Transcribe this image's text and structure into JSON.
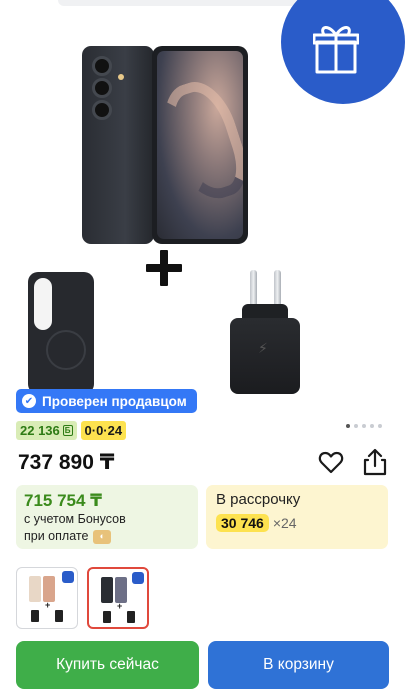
{
  "product": {
    "images": {
      "current_index": 1,
      "count": 5
    },
    "seller_badge": "Проверен продавцом",
    "bonus_chip": "22 136",
    "bonus_chip_unit": "Б",
    "installment_chip": "0·0·24",
    "price": "737 890 ₸",
    "bonus_box": {
      "amount": "715 754 ₸",
      "line1": "с учетом Бонусов",
      "line2": "при оплате"
    },
    "installment_box": {
      "title": "В рассрочку",
      "monthly": "30 746",
      "months": "×24"
    }
  },
  "icons": {
    "gift": "gift-icon",
    "favorite": "heart-icon",
    "share": "share-icon",
    "verified": "check-circle-icon"
  },
  "actions": {
    "buy_now": "Купить сейчас",
    "add_to_cart": "В корзину"
  },
  "colors": {
    "buy": "#3fae49",
    "cart": "#2f72d6",
    "verified": "#3478f6",
    "gift_badge": "#2a5cc9",
    "selected_outline": "#e0493c"
  }
}
